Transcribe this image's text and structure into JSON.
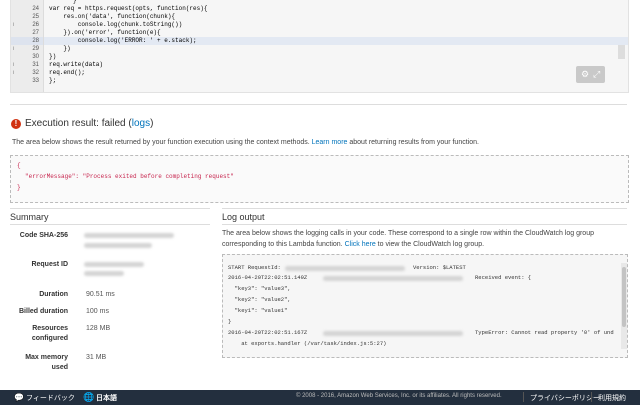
{
  "editor": {
    "lines": [
      {
        "num": "24",
        "fold": "",
        "code": "var req = https.request(opts, function(res){"
      },
      {
        "num": "25",
        "fold": "",
        "code": "    res.on('data', function(chunk){"
      },
      {
        "num": "26",
        "fold": "i",
        "code": "        console.log(chunk.toString())"
      },
      {
        "num": "27",
        "fold": "",
        "code": "    }).on('error', function(e){"
      },
      {
        "num": "28",
        "fold": "",
        "code": "        console.log('ERROR: ' + e.stack);"
      },
      {
        "num": "29",
        "fold": "i",
        "code": "    })"
      },
      {
        "num": "30",
        "fold": "",
        "code": "})"
      },
      {
        "num": "31",
        "fold": "i",
        "code": "req.write(data)"
      },
      {
        "num": "32",
        "fold": "i",
        "code": "req.end();"
      },
      {
        "num": "33",
        "fold": "",
        "code": "};"
      }
    ],
    "top_brace": "}"
  },
  "result": {
    "title": "Execution result: failed (",
    "logs_link": "logs",
    "title_end": ")",
    "description_pre": "The area below shows the result returned by your function execution using the context methods.",
    "learn_more": "Learn more",
    "description_post": "about returning results from your function.",
    "open_brace": "{",
    "error_key": "\"errorMessage\"",
    "error_value": "\"Process exited before completing request\"",
    "close_brace": "}"
  },
  "summary": {
    "title": "Summary",
    "rows": [
      {
        "label": "Code SHA-256",
        "value": ""
      },
      {
        "label": "Request ID",
        "value": ""
      },
      {
        "label": "Duration",
        "value": "90.51 ms"
      },
      {
        "label": "Billed duration",
        "value": "100 ms"
      },
      {
        "label": "Resources configured",
        "value": "128 MB"
      },
      {
        "label": "Max memory used",
        "value": "31 MB"
      }
    ]
  },
  "log": {
    "title": "Log output",
    "desc_1": "The area below shows the logging calls in your code. These correspond to a single row within the CloudWatch log group",
    "desc_2_pre": "corresponding to this Lambda function.",
    "click_here": "Click here",
    "desc_2_post": "to view the CloudWatch log group.",
    "lines": [
      "START RequestId:",
      "Version: $LATEST",
      "2016-04-20T22:02:51.149Z",
      "Received event: {",
      "  \"key3\": \"value3\",",
      "  \"key2\": \"value2\",",
      "  \"key1\": \"value1\"",
      "}",
      "2016-04-20T22:02:51.167Z",
      "TypeError: Cannot read property '0' of und",
      "    at exports.handler (/var/task/index.js:5:27)"
    ]
  },
  "footer": {
    "feedback": "フィードバック",
    "language": "日本語",
    "copyright": "© 2008 - 2016, Amazon Web Services, Inc. or its affiliates. All rights reserved.",
    "privacy": "プライバシーポリシー",
    "terms": "利用規約"
  },
  "icons": [
    "chat-bubble-icon",
    "globe-icon",
    "settings-gear-icon",
    "fullscreen-icon",
    "error-icon"
  ],
  "colors": {
    "error": "#d13212",
    "link": "#0073bb",
    "footer_bg": "#232f3e",
    "error_text": "#c7254e"
  }
}
